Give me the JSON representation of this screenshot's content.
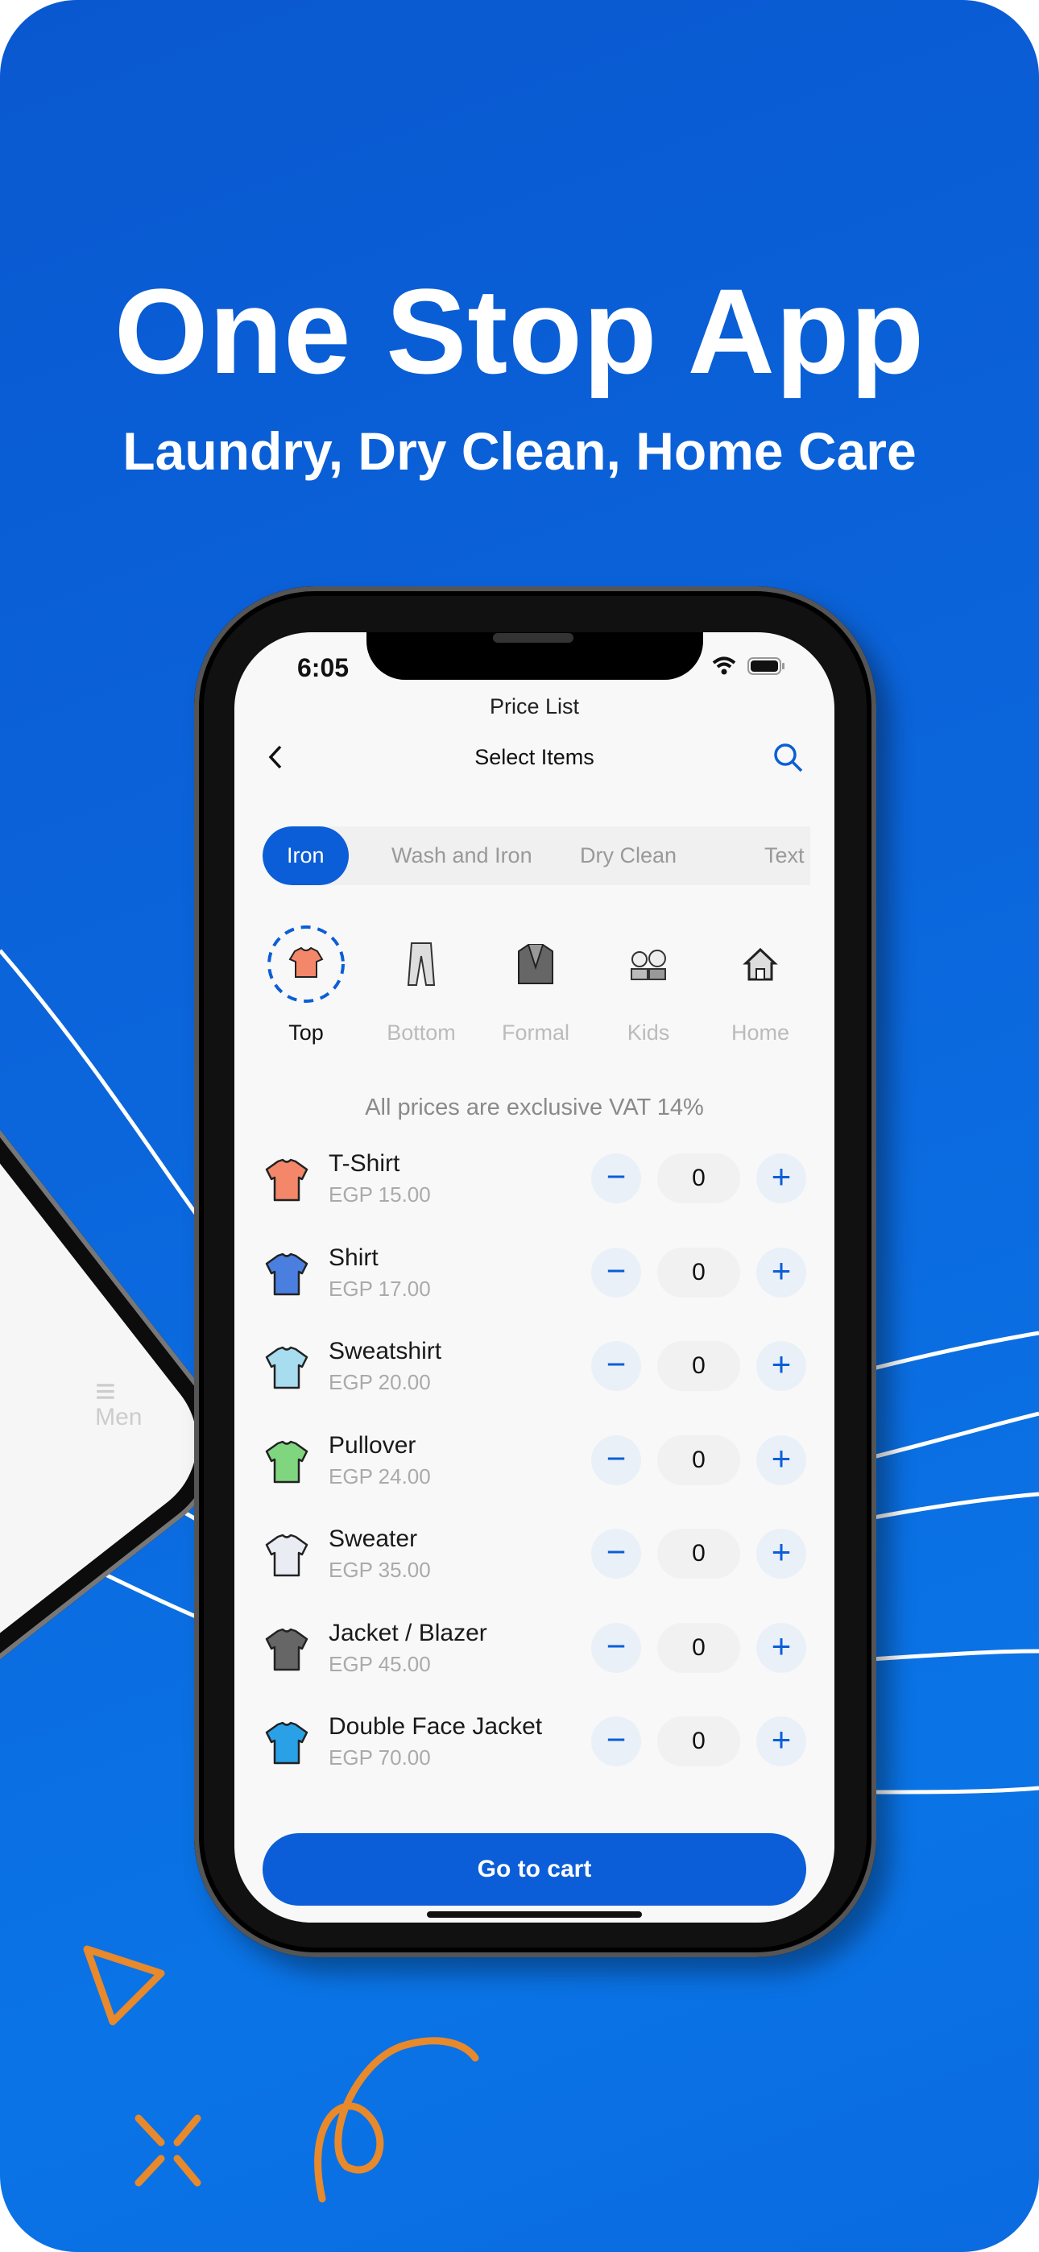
{
  "promo": {
    "headline": "One Stop App",
    "subheadline": "Laundry, Dry Clean, Home Care"
  },
  "colors": {
    "background": "#0a62d8",
    "accent": "#0b5ed7",
    "decoration": "#e8892b"
  },
  "left_phone": {
    "menu_label": "Men"
  },
  "status_bar": {
    "time": "6:05",
    "icons": [
      "wifi-icon",
      "battery-icon"
    ]
  },
  "header": {
    "title": "Price List",
    "subtitle": "Select Items",
    "back_icon": "chevron-left-icon",
    "search_icon": "search-icon"
  },
  "service_tabs": [
    {
      "label": "Iron",
      "active": true
    },
    {
      "label": "Wash and Iron",
      "active": false
    },
    {
      "label": "Dry Clean",
      "active": false
    },
    {
      "label": "Text",
      "active": false
    }
  ],
  "categories": [
    {
      "label": "Top",
      "icon": "tshirt-icon",
      "active": true
    },
    {
      "label": "Bottom",
      "icon": "pants-icon",
      "active": false
    },
    {
      "label": "Formal",
      "icon": "blazer-icon",
      "active": false
    },
    {
      "label": "Kids",
      "icon": "kids-icon",
      "active": false
    },
    {
      "label": "Home",
      "icon": "house-icon",
      "active": false
    }
  ],
  "vat_note": "All prices are exclusive VAT 14%",
  "items": [
    {
      "name": "T-Shirt",
      "price": "EGP 15.00",
      "qty": "0",
      "icon": "tshirt-icon"
    },
    {
      "name": "Shirt",
      "price": "EGP 17.00",
      "qty": "0",
      "icon": "shirt-icon"
    },
    {
      "name": "Sweatshirt",
      "price": "EGP 20.00",
      "qty": "0",
      "icon": "hoodie-icon"
    },
    {
      "name": "Pullover",
      "price": "EGP 24.00",
      "qty": "0",
      "icon": "pullover-icon"
    },
    {
      "name": "Sweater",
      "price": "EGP 35.00",
      "qty": "0",
      "icon": "sweater-icon"
    },
    {
      "name": "Jacket / Blazer",
      "price": "EGP 45.00",
      "qty": "0",
      "icon": "jacket-icon"
    },
    {
      "name": "Double Face Jacket",
      "price": "EGP 70.00",
      "qty": "0",
      "icon": "puffer-jacket-icon"
    }
  ],
  "stepper": {
    "minus": "−",
    "plus": "+"
  },
  "cart_button": "Go to cart"
}
